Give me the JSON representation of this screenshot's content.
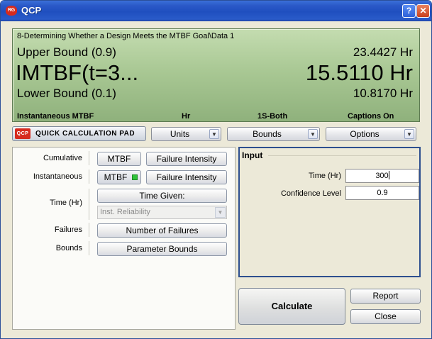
{
  "window": {
    "title": "QCP",
    "app_icon_text": "RG",
    "help_glyph": "?",
    "close_glyph": "✕"
  },
  "display": {
    "path": "8-Determining Whether a Design Meets the MTBF Goal\\Data 1",
    "upper_label": "Upper Bound (0.9)",
    "upper_value": "23.4427 Hr",
    "main_label": "IMTBF(t=3...",
    "main_value": "15.5110 Hr",
    "lower_label": "Lower Bound (0.1)",
    "lower_value": "10.8170 Hr",
    "status": {
      "metric": "Instantaneous MTBF",
      "unit": "Hr",
      "bounds": "1S-Both",
      "captions": "Captions On"
    }
  },
  "toolbar": {
    "pad_logo": "QCP",
    "pad_label": "Quick Calculation Pad",
    "units_label": "Units",
    "bounds_label": "Bounds",
    "options_label": "Options",
    "arrow_glyph": "▼"
  },
  "left_panel": {
    "cumulative_label": "Cumulative",
    "instantaneous_label": "Instantaneous",
    "time_label": "Time (Hr)",
    "failures_label": "Failures",
    "bounds_label": "Bounds",
    "mtbf_label": "MTBF",
    "failure_intensity_label": "Failure Intensity",
    "time_given_label": "Time Given:",
    "select_value": "Inst. Reliability",
    "number_failures_label": "Number of Failures",
    "parameter_bounds_label": "Parameter Bounds"
  },
  "input": {
    "legend": "Input",
    "time_label": "Time (Hr)",
    "time_value": "300",
    "confidence_label": "Confidence Level",
    "confidence_value": "0.9"
  },
  "actions": {
    "calculate_label": "Calculate",
    "report_label": "Report",
    "close_label": "Close"
  },
  "colors": {
    "titlebar": "#2a58c7",
    "lcd": "#a9c894",
    "led_on": "#2fc23a",
    "input_border": "#2d4f8f"
  }
}
